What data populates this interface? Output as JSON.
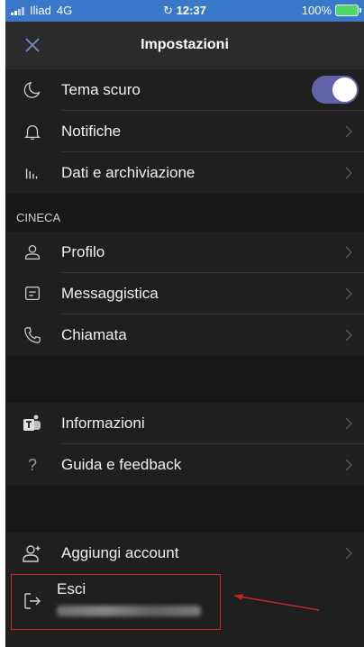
{
  "status_bar": {
    "carrier": "Iliad",
    "network": "4G",
    "time": "12:37",
    "battery": "100%"
  },
  "header": {
    "title": "Impostazioni",
    "close_icon": "close-icon"
  },
  "settings_group_1": [
    {
      "label": "Tema scuro",
      "icon": "moon-icon",
      "toggle_on": true
    },
    {
      "label": "Notifiche",
      "icon": "bell-icon"
    },
    {
      "label": "Dati e archiviazione",
      "icon": "data-bars-icon"
    }
  ],
  "section_cineca": {
    "title": "CINECA",
    "items": [
      {
        "label": "Profilo",
        "icon": "profile-icon"
      },
      {
        "label": "Messaggistica",
        "icon": "message-icon"
      },
      {
        "label": "Chiamata",
        "icon": "phone-icon"
      }
    ]
  },
  "settings_group_2": [
    {
      "label": "Informazioni",
      "icon": "teams-icon"
    },
    {
      "label": "Guida e feedback",
      "icon": "question-icon"
    }
  ],
  "account": {
    "add_label": "Aggiungi account",
    "logout_label": "Esci"
  },
  "colors": {
    "background": "#1f1f1f",
    "accent_toggle": "#6264a7",
    "status_bar": "#3a78c9",
    "highlight_red": "#c62828"
  }
}
